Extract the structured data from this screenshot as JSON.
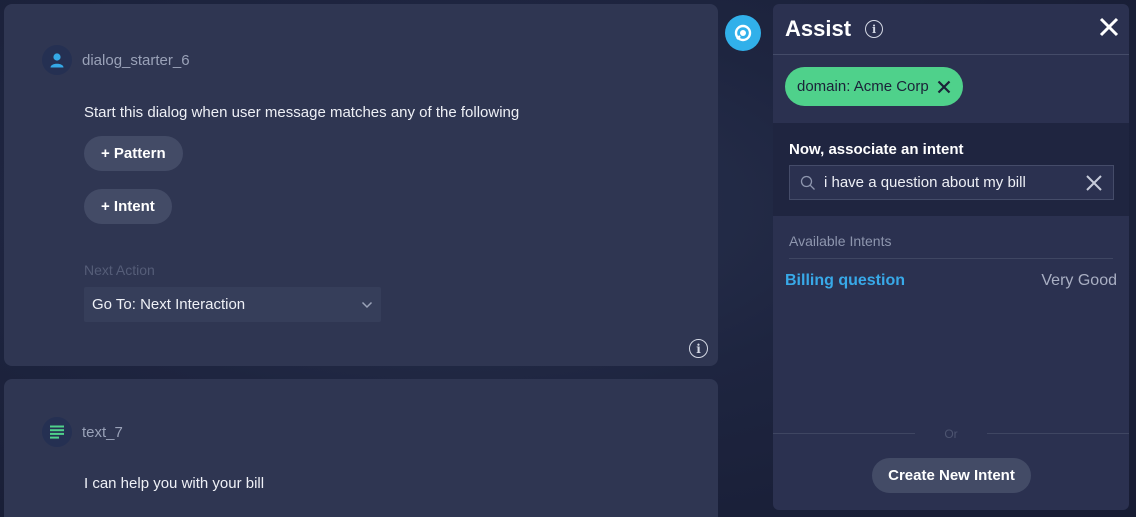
{
  "dialog_card": {
    "node_name": "dialog_starter_6",
    "description": "Start this dialog when user message matches any of the following",
    "pattern_button": "+ Pattern",
    "intent_button": "+ Intent",
    "next_action_label": "Next Action",
    "next_action_value": "Go To: Next Interaction",
    "icon": "user-icon"
  },
  "text_card": {
    "node_name": "text_7",
    "body": "I can help you with your bill",
    "icon": "text-lines-icon"
  },
  "assist_panel": {
    "title": "Assist",
    "domain_chip": "domain: Acme Corp",
    "associate_label": "Now, associate an intent",
    "search_value": "i have a question about my bill",
    "available_label": "Available Intents",
    "intents": [
      {
        "name": "Billing question",
        "score": "Very Good"
      }
    ],
    "or_text": "Or",
    "create_button": "Create New Intent"
  },
  "colors": {
    "accent_blue": "#31b0ea",
    "chip_green": "#4fd18b",
    "intent_link": "#38a9e8"
  }
}
